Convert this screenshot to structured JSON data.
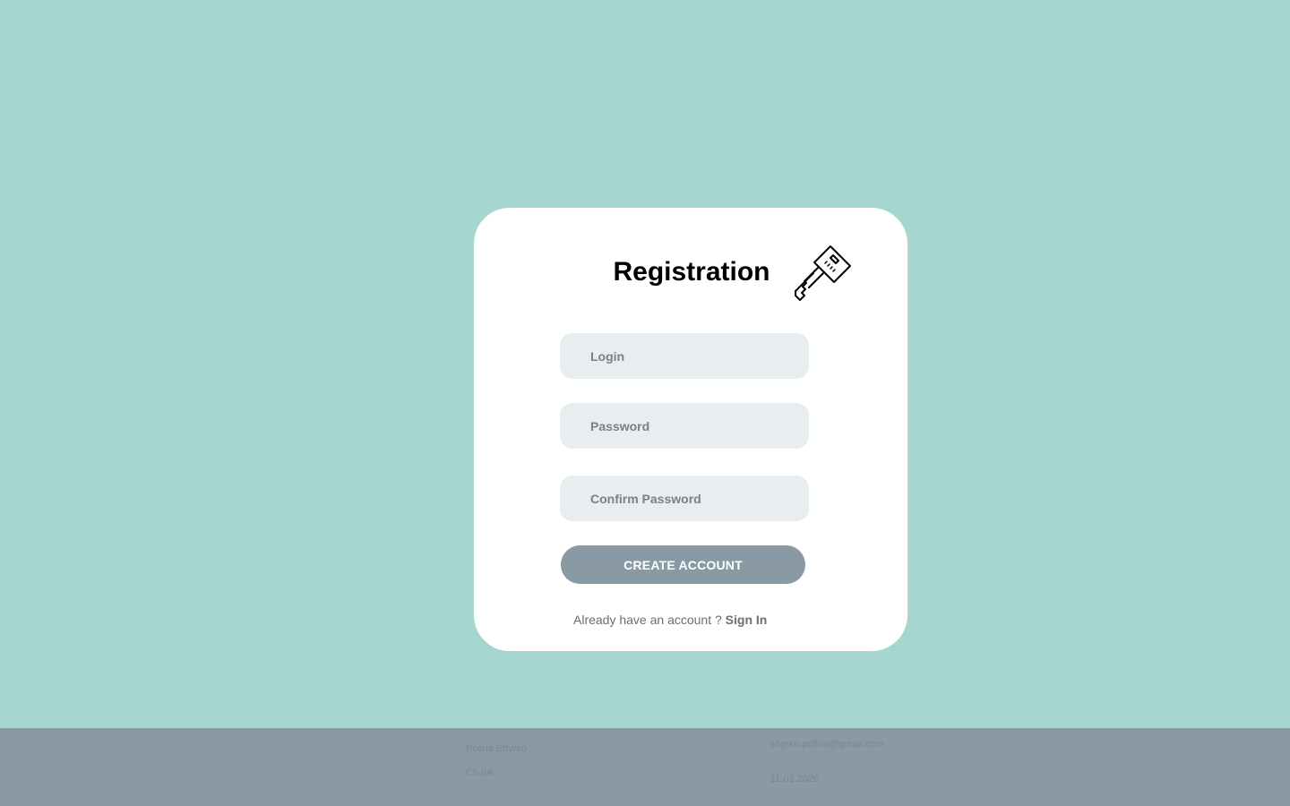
{
  "card": {
    "title": "Registration",
    "icon": "key-icon",
    "fields": {
      "login_placeholder": "Login",
      "login_value": "",
      "password_placeholder": "Password",
      "password_value": "",
      "confirm_placeholder": "Confirm Password",
      "confirm_value": ""
    },
    "create_button_label": "CREATE ACCOUNT",
    "signin_prompt": "Already have an account ?",
    "signin_link": "Sign In"
  },
  "footer": {
    "author": "Polina Shyrko",
    "app_name": "Chatik",
    "email": "shyrko.polina@gmail.com",
    "date": "11.01.2020"
  },
  "colors": {
    "background": "#a7d5cf",
    "card": "#ffffff",
    "field": "#e8edf0",
    "button": "#8a9aa5",
    "footer": "#8a9aa5"
  }
}
